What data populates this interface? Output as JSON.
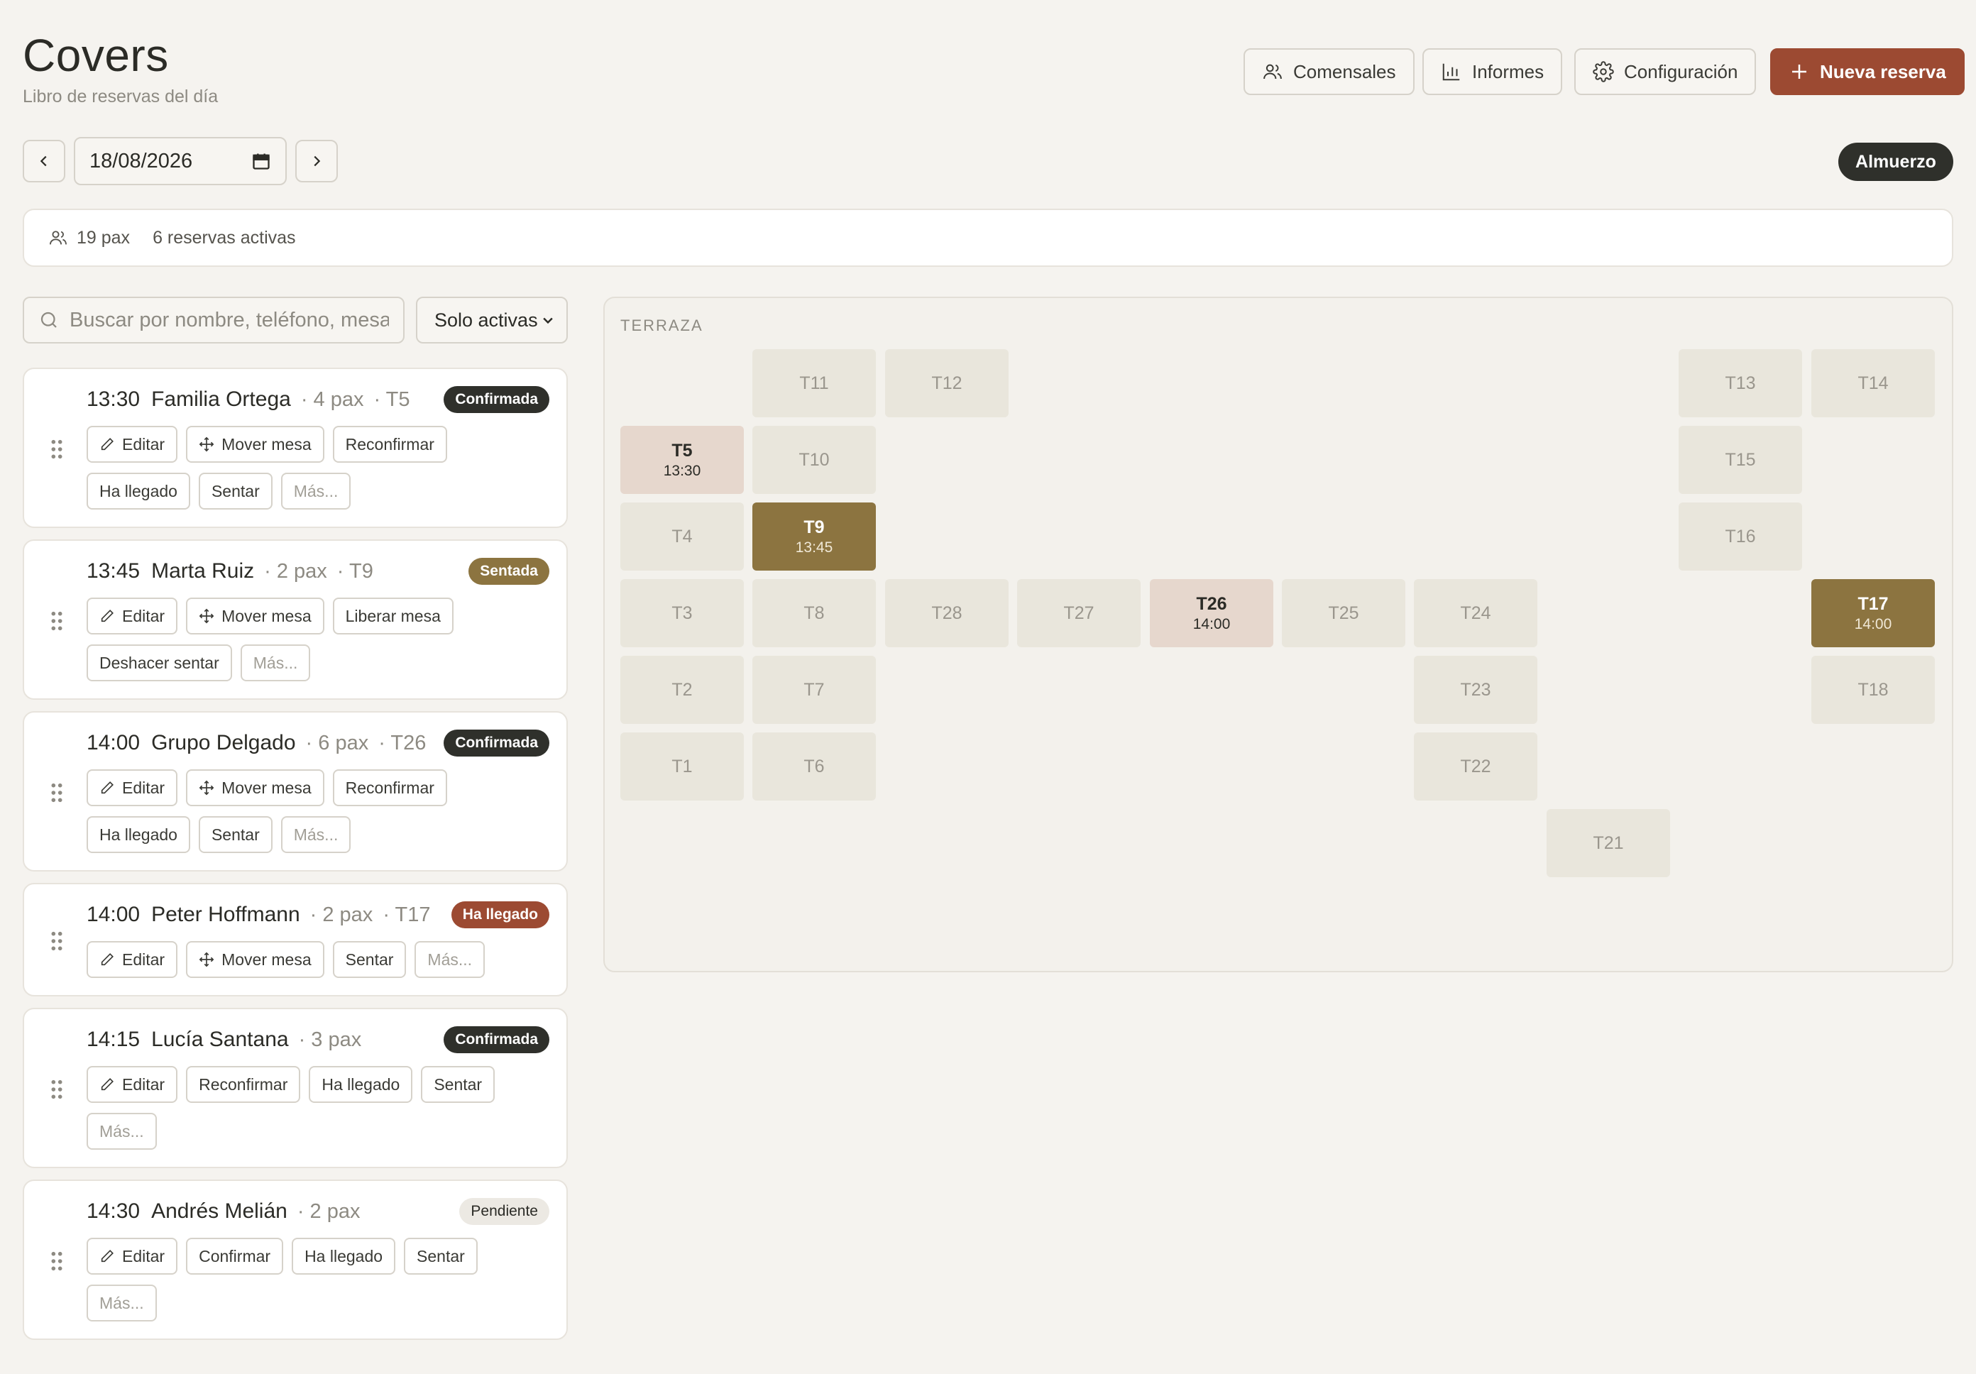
{
  "header": {
    "title": "Covers",
    "subtitle": "Libro de reservas del día",
    "buttons": {
      "guests": "Comensales",
      "reports": "Informes",
      "settings": "Configuración",
      "new_booking": "Nueva reserva"
    }
  },
  "date_nav": {
    "date": "18/08/2026",
    "service": "Almuerzo"
  },
  "summary": {
    "pax": "19 pax",
    "active": "6 reservas activas"
  },
  "search": {
    "placeholder": "Buscar por nombre, teléfono, mesa..."
  },
  "filter": {
    "selected": "Solo activas"
  },
  "reservations": [
    {
      "time": "13:30",
      "name": "Familia Ortega",
      "pax": "· 4 pax",
      "table": "· T5",
      "status": "Confirmada",
      "actions": [
        "Editar",
        "Mover mesa",
        "Reconfirmar",
        "Ha llegado",
        "Sentar",
        "Más..."
      ]
    },
    {
      "time": "13:45",
      "name": "Marta Ruiz",
      "pax": "· 2 pax",
      "table": "· T9",
      "status": "Sentada",
      "actions": [
        "Editar",
        "Mover mesa",
        "Liberar mesa",
        "Deshacer sentar",
        "Más..."
      ]
    },
    {
      "time": "14:00",
      "name": "Grupo Delgado",
      "pax": "· 6 pax",
      "table": "· T26",
      "status": "Confirmada",
      "actions": [
        "Editar",
        "Mover mesa",
        "Reconfirmar",
        "Ha llegado",
        "Sentar",
        "Más..."
      ]
    },
    {
      "time": "14:00",
      "name": "Peter Hoffmann",
      "pax": "· 2 pax",
      "table": "· T17",
      "status": "Ha llegado",
      "actions": [
        "Editar",
        "Mover mesa",
        "Sentar",
        "Más..."
      ]
    },
    {
      "time": "14:15",
      "name": "Lucía Santana",
      "pax": "· 3 pax",
      "table": "",
      "status": "Confirmada",
      "actions": [
        "Editar",
        "Reconfirmar",
        "Ha llegado",
        "Sentar",
        "Más..."
      ]
    },
    {
      "time": "14:30",
      "name": "Andrés Melián",
      "pax": "· 2 pax",
      "table": "",
      "status": "Pendiente",
      "actions": [
        "Editar",
        "Confirmar",
        "Ha llegado",
        "Sentar",
        "Más..."
      ]
    }
  ],
  "floor": {
    "zone": "TERRAZA",
    "tables": [
      {
        "name": "T11",
        "time": "",
        "state": "free"
      },
      {
        "name": "T12",
        "time": "",
        "state": "free"
      },
      {
        "name": "T13",
        "time": "",
        "state": "free"
      },
      {
        "name": "T14",
        "time": "",
        "state": "free"
      },
      {
        "name": "T5",
        "time": "13:30",
        "state": "booked"
      },
      {
        "name": "T10",
        "time": "",
        "state": "free"
      },
      {
        "name": "T15",
        "time": "",
        "state": "free"
      },
      {
        "name": "T4",
        "time": "",
        "state": "free"
      },
      {
        "name": "T9",
        "time": "13:45",
        "state": "seated"
      },
      {
        "name": "T16",
        "time": "",
        "state": "free"
      },
      {
        "name": "T3",
        "time": "",
        "state": "free"
      },
      {
        "name": "T8",
        "time": "",
        "state": "free"
      },
      {
        "name": "T28",
        "time": "",
        "state": "free"
      },
      {
        "name": "T27",
        "time": "",
        "state": "free"
      },
      {
        "name": "T26",
        "time": "14:00",
        "state": "booked"
      },
      {
        "name": "T25",
        "time": "",
        "state": "free"
      },
      {
        "name": "T24",
        "time": "",
        "state": "free"
      },
      {
        "name": "T17",
        "time": "14:00",
        "state": "seated"
      },
      {
        "name": "T2",
        "time": "",
        "state": "free"
      },
      {
        "name": "T7",
        "time": "",
        "state": "free"
      },
      {
        "name": "T23",
        "time": "",
        "state": "free"
      },
      {
        "name": "T18",
        "time": "",
        "state": "free"
      },
      {
        "name": "T1",
        "time": "",
        "state": "free"
      },
      {
        "name": "T6",
        "time": "",
        "state": "free"
      },
      {
        "name": "T22",
        "time": "",
        "state": "free"
      },
      {
        "name": "T21",
        "time": "",
        "state": "free"
      }
    ]
  }
}
